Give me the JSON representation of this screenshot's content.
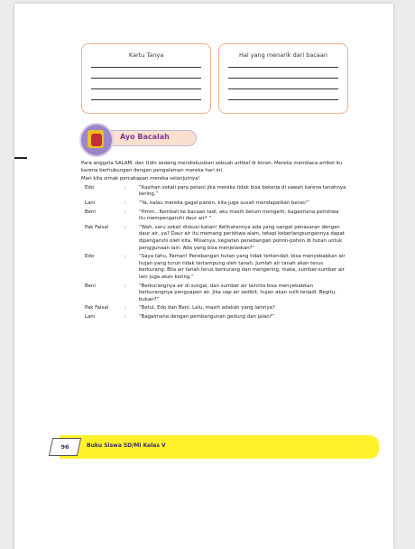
{
  "cards": {
    "left_title": "Kartu Tanya",
    "right_title": "Hal yang menarik dari bacaan"
  },
  "section": {
    "title": "Ayo Bacalah"
  },
  "intro": {
    "p1": "Para anggota SALAM, dan Udin sedang mendiskusikan sebuah artikel di koran. Mereka membaca artikel itu karena berhubungan dengan pengalaman mereka hari ini.",
    "p2": "Mari kita simak percakapan mereka selanjutnya!"
  },
  "dialog": [
    {
      "speaker": "Edo",
      "text": "“Kasihan sekali para petani jika mereka tidak bisa bekerja di sawah karena tanahnya kering.”"
    },
    {
      "speaker": "Lani",
      "text": "“Ya, kalau mereka gagal panen, kita juga susah mendapatkan beras!”"
    },
    {
      "speaker": "Beni",
      "text": "“Hmm…Kembali ke bacaan tadi, aku masih belum mengerti, bagaimana peristiwa itu mempengaruhi daur air? ”"
    },
    {
      "speaker": "Pak Faisal",
      "text": "“Wah, seru sekali diskusi kalian! Kelihatannya ada yang sangat penasaran dengan daur air, ya? Daur air itu memang peristiwa alam, tetapi keberlangsungannya dapat dipengaruhi oleh kita. Misalnya, kegiatan penebangan pohon-pohon di hutan untuk penggunaan lain. Ada yang bisa menjelaskan?”"
    },
    {
      "speaker": "Edo",
      "text": "“Saya tahu, Paman! Penebangan hutan yang tidak terkendali, bisa menyebabkan air hujan yang turun tidak tertampung oleh tanah. Jumlah air tanah akan terus berkurang. Bila air tanah terus berkurang dan mengering, maka, sumber-sumber air lain juga akan kering.”"
    },
    {
      "speaker": "Beni",
      "text": "“Berkurangnya air di sungai, dan sumber air lainnta bisa menyebabkan berkurangnya penguapan air. Jika uap air sedikit, hujan akan sulit terjadi. Begitu, bukan?”"
    },
    {
      "speaker": "Pak Faisal",
      "text": "“Betul, Edo dan Beni. Lalu, masih adakah yang lainnya?"
    },
    {
      "speaker": "Lani",
      "text": "“Bagaimana dengan pembangunan gedung dan jalan?”"
    }
  ],
  "footer": {
    "page_number": "96",
    "book_title": "Buku Siswa SD/MI Kelas V"
  },
  "colors": {
    "card_border": "#f0b08e",
    "footer_bg": "#fff22a",
    "title_color": "#7a3a8c"
  }
}
